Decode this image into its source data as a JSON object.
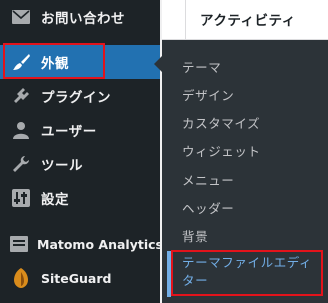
{
  "menu": {
    "contact": {
      "label": "お問い合わせ",
      "icon": "envelope-icon"
    },
    "appearance": {
      "label": "外観",
      "icon": "paintbrush-icon"
    },
    "plugins": {
      "label": "プラグイン",
      "icon": "plugin-icon"
    },
    "users": {
      "label": "ユーザー",
      "icon": "user-icon"
    },
    "tools": {
      "label": "ツール",
      "icon": "wrench-icon"
    },
    "settings": {
      "label": "設定",
      "icon": "settings-icon"
    },
    "matomo": {
      "label": "Matomo Analytics",
      "icon": "matomo-icon"
    },
    "siteguard": {
      "label": "SiteGuard",
      "icon": "siteguard-icon"
    }
  },
  "submenu": {
    "themes": "テーマ",
    "design": "デザイン",
    "customize": "カスタマイズ",
    "widgets": "ウィジェット",
    "menus": "メニュー",
    "header": "ヘッダー",
    "background": "背景",
    "theme_file_editor_line1": "テーマファイルエディ",
    "theme_file_editor_line2": "ター"
  },
  "content": {
    "title": "アクティビティ"
  },
  "colors": {
    "sidebar_bg": "#1d2327",
    "submenu_bg": "#2c3338",
    "accent": "#2271b1",
    "active_link": "#72aee6",
    "annotation_red": "#e3131b"
  }
}
